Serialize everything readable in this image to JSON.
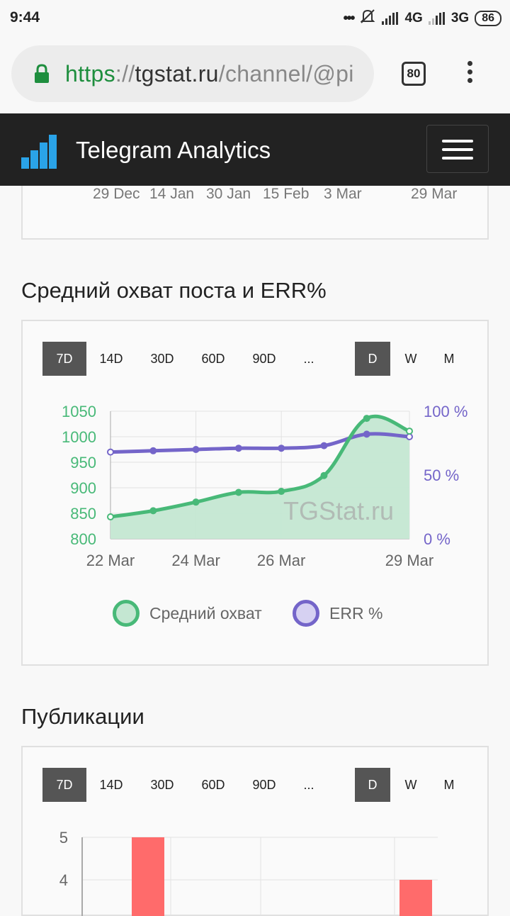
{
  "status": {
    "time": "9:44",
    "net1": "4G",
    "net2": "3G",
    "battery": "86"
  },
  "browser": {
    "url_scheme": "https",
    "url_sep": "://",
    "url_host": "tgstat.ru",
    "url_path": "/channel/@pi",
    "tab_count": "80"
  },
  "navbar": {
    "brand": "Telegram Analytics"
  },
  "top_card": {
    "ticks": [
      "29 Dec",
      "14 Jan",
      "30 Jan",
      "15 Feb",
      "3 Mar",
      "29 Mar"
    ]
  },
  "reach_section": {
    "title": "Средний охват поста и ERR%",
    "periods": [
      "7D",
      "14D",
      "30D",
      "60D",
      "90D",
      "..."
    ],
    "grouping": [
      "D",
      "W",
      "M"
    ],
    "active_period": "7D",
    "active_grouping": "D",
    "watermark": "TGStat.ru",
    "legend": [
      {
        "label": "Средний охват",
        "color": "#48b978",
        "fill": "#c4e7d2"
      },
      {
        "label": "ERR %",
        "color": "#7465c9",
        "fill": "#d6d1f2"
      }
    ]
  },
  "publications_section": {
    "title": "Публикации",
    "periods": [
      "7D",
      "14D",
      "30D",
      "60D",
      "90D",
      "..."
    ],
    "grouping": [
      "D",
      "W",
      "M"
    ],
    "active_period": "7D",
    "active_grouping": "D"
  },
  "chart_data": [
    {
      "type": "line",
      "x": [
        "22 Mar",
        "23 Mar",
        "24 Mar",
        "25 Mar",
        "26 Mar",
        "27 Mar",
        "28 Mar",
        "29 Mar"
      ],
      "x_tick_labels": [
        "22 Mar",
        "24 Mar",
        "26 Mar",
        "29 Mar"
      ],
      "y_tick_labels_left": [
        "1050",
        "1000",
        "950",
        "900",
        "850",
        "800"
      ],
      "y_tick_labels_right": [
        "100 %",
        "50 %",
        "0 %"
      ],
      "ylim_left": [
        800,
        1050
      ],
      "ylim_right": [
        0,
        100
      ],
      "series": [
        {
          "name": "Средний охват",
          "axis": "left",
          "values": [
            843,
            855,
            872,
            891,
            893,
            924,
            1036,
            1011
          ]
        },
        {
          "name": "ERR %",
          "axis": "right",
          "values": [
            68,
            69,
            70,
            71,
            71,
            73,
            82,
            80
          ]
        }
      ],
      "grid": true
    },
    {
      "type": "bar",
      "y_tick_labels": [
        "5",
        "4"
      ],
      "visible_values": [
        5,
        4
      ],
      "color": "#ff6b6b",
      "grid": true
    }
  ]
}
